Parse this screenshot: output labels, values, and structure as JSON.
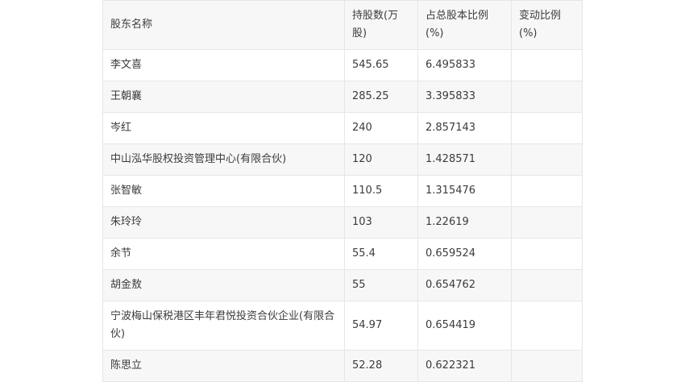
{
  "table": {
    "headers": [
      "股东名称",
      "持股数(万股)",
      "占总股本比例(%)",
      "变动比例(%)"
    ],
    "rows": [
      [
        "李文喜",
        "545.65",
        "6.495833",
        ""
      ],
      [
        "王朝襄",
        "285.25",
        "3.395833",
        ""
      ],
      [
        "岑红",
        "240",
        "2.857143",
        ""
      ],
      [
        "中山泓华股权投资管理中心(有限合伙)",
        "120",
        "1.428571",
        ""
      ],
      [
        "张智敏",
        "110.5",
        "1.315476",
        ""
      ],
      [
        "朱玲玲",
        "103",
        "1.22619",
        ""
      ],
      [
        "余节",
        "55.4",
        "0.659524",
        ""
      ],
      [
        "胡金敖",
        "55",
        "0.654762",
        ""
      ],
      [
        "宁波梅山保税港区丰年君悦投资合伙企业(有限合伙)",
        "54.97",
        "0.654419",
        ""
      ],
      [
        "陈思立",
        "52.28",
        "0.622321",
        ""
      ]
    ]
  }
}
